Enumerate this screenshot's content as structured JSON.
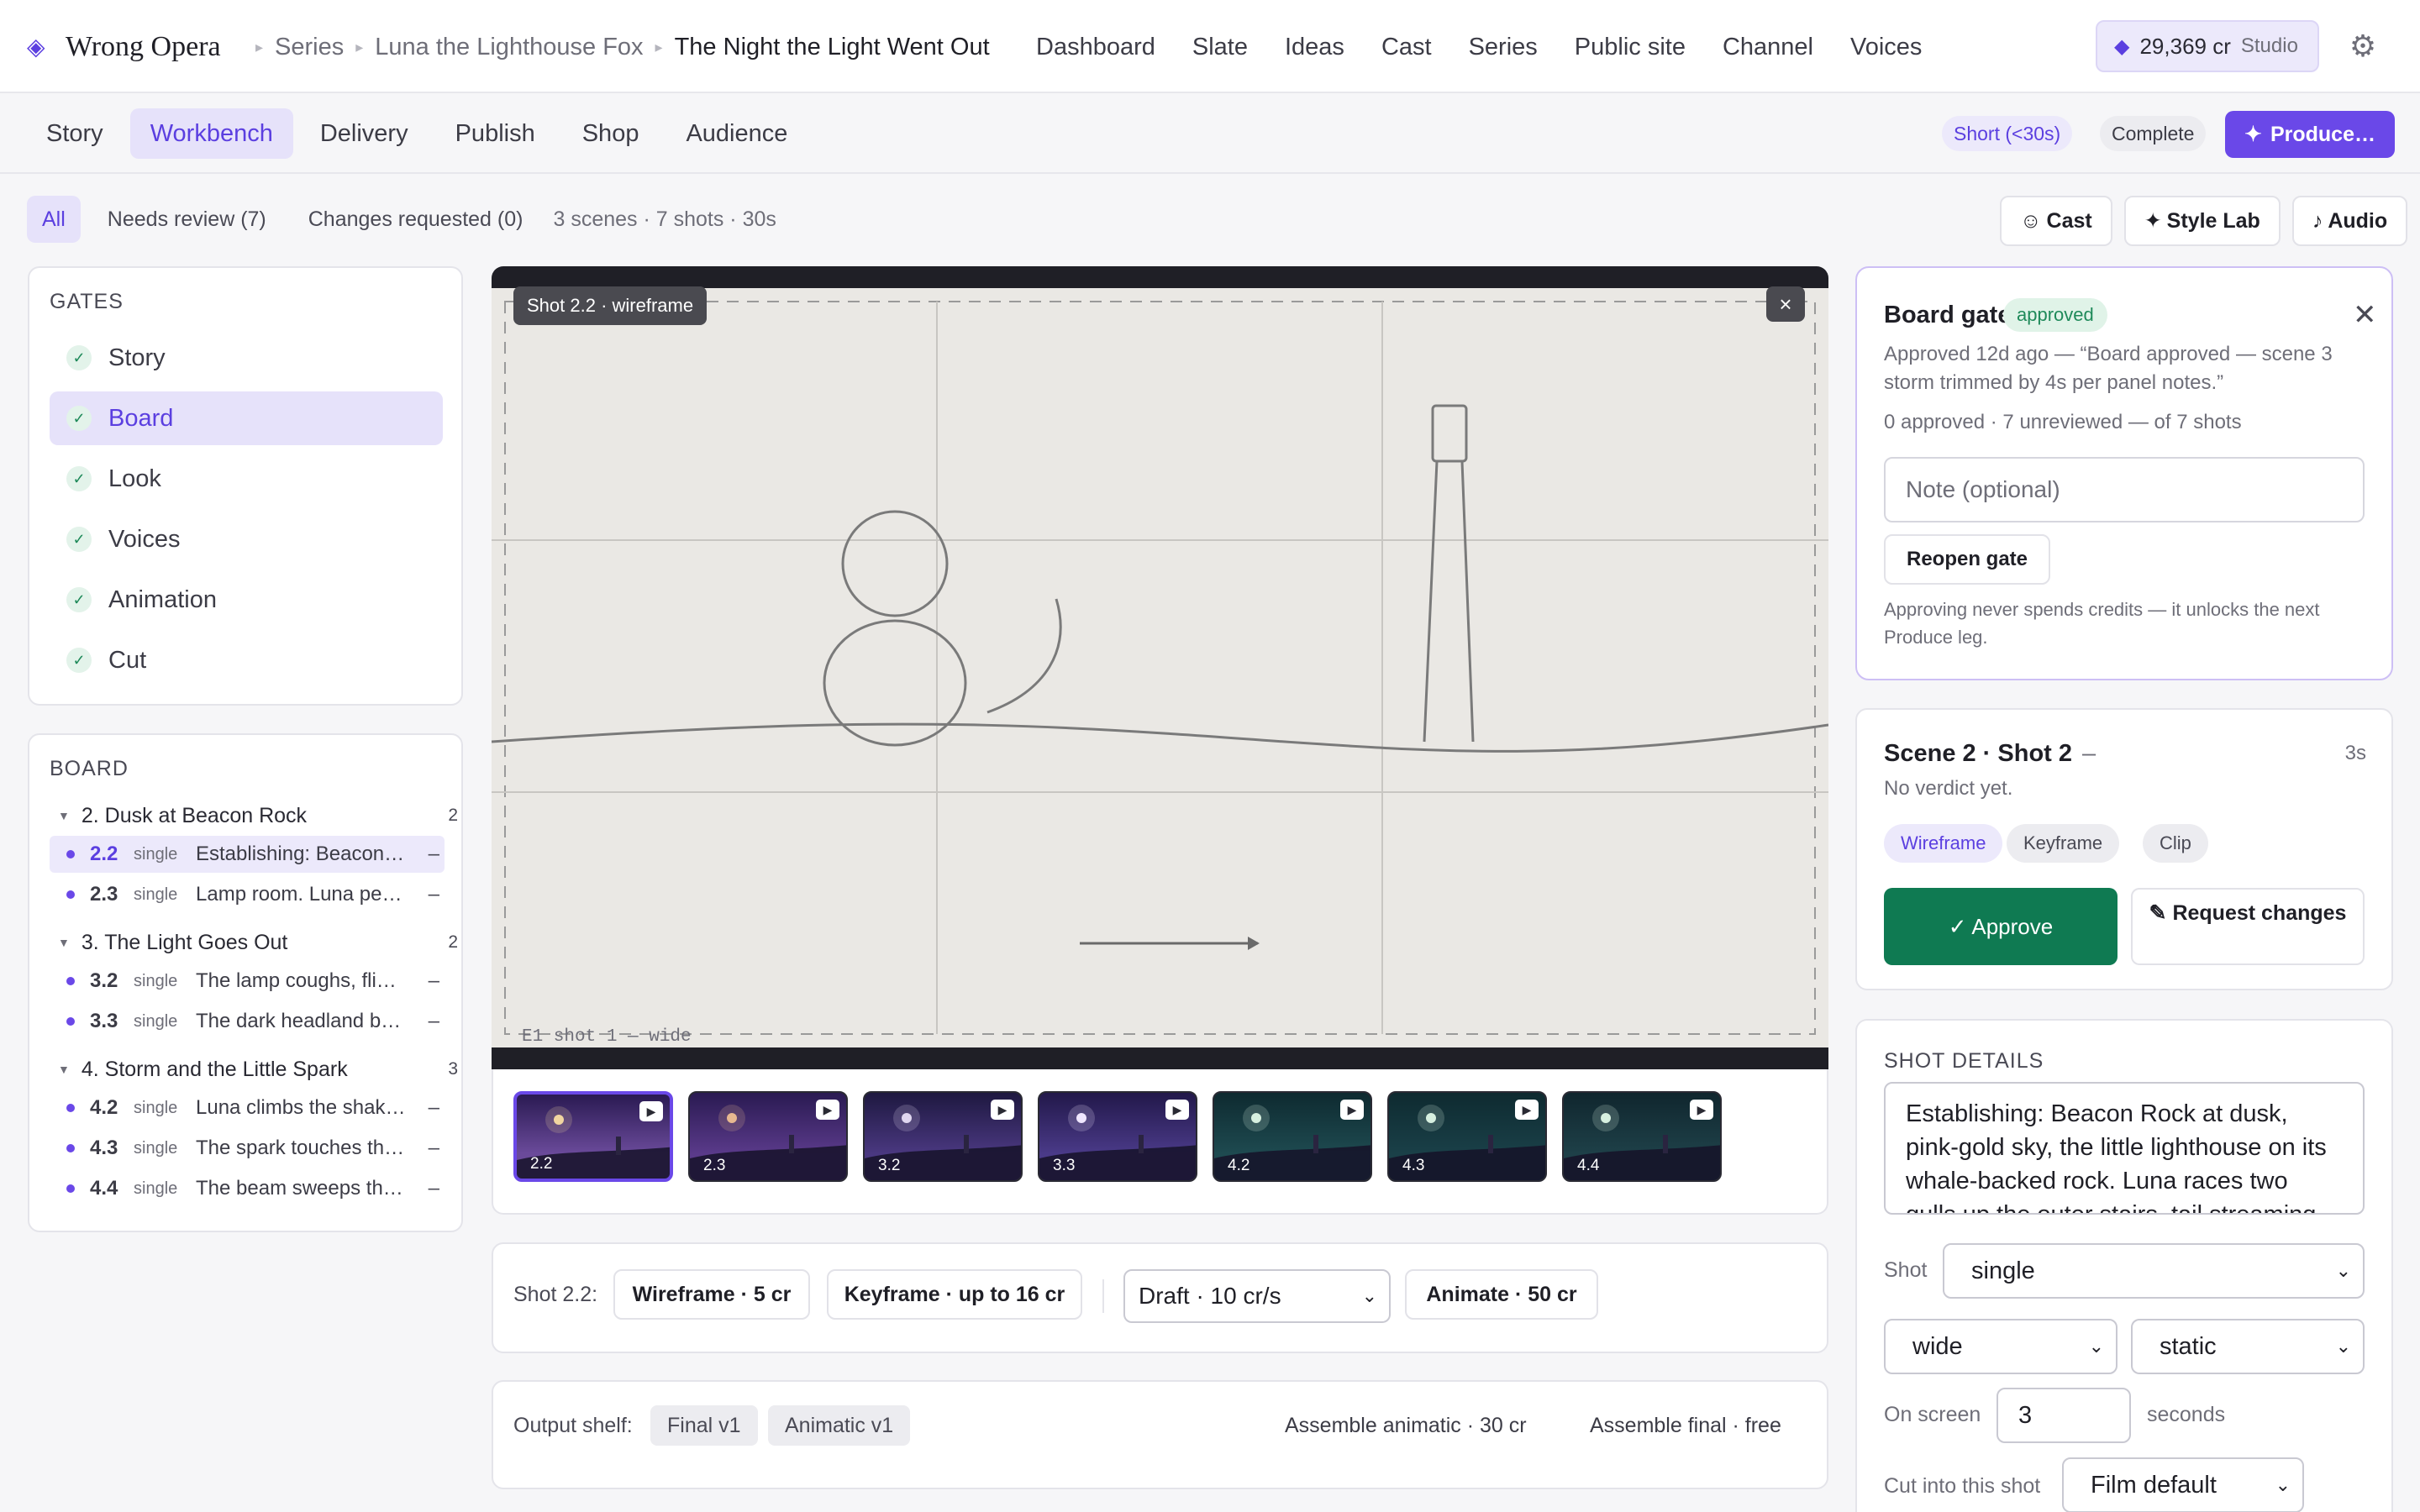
{
  "app": {
    "name": "Wrong Opera",
    "logo_icon": "diamond-icon"
  },
  "breadcrumb": [
    "Series",
    "Luna the Lighthouse Fox",
    "The Night the Light Went Out"
  ],
  "topnav": [
    "Dashboard",
    "Slate",
    "Ideas",
    "Cast",
    "Series",
    "Public site",
    "Channel",
    "Voices"
  ],
  "credits": {
    "amount": "29,369 cr",
    "plan": "Studio"
  },
  "tabs": [
    {
      "label": "Story"
    },
    {
      "label": "Workbench",
      "active": true
    },
    {
      "label": "Delivery"
    },
    {
      "label": "Publish"
    },
    {
      "label": "Shop"
    },
    {
      "label": "Audience"
    }
  ],
  "status": {
    "length": "Short (<30s)",
    "state": "Complete",
    "produce": "Produce…"
  },
  "filters": {
    "all": "All",
    "needs_review": "Needs review (7)",
    "changes": "Changes requested (0)",
    "meta": "3 scenes · 7 shots · 30s"
  },
  "tools": {
    "cast": "Cast",
    "style_lab": "Style Lab",
    "audio": "Audio"
  },
  "gates": {
    "title": "GATES",
    "items": [
      {
        "label": "Story"
      },
      {
        "label": "Board",
        "active": true
      },
      {
        "label": "Look"
      },
      {
        "label": "Voices"
      },
      {
        "label": "Animation"
      },
      {
        "label": "Cut"
      }
    ]
  },
  "board": {
    "title": "BOARD",
    "groups": [
      {
        "title": "2. Dusk at Beacon Rock",
        "count": "2",
        "shots": [
          {
            "num": "2.2",
            "kind": "single",
            "text": "Establishing: Beacon Rock at dusk",
            "mark": "–",
            "active": true
          },
          {
            "num": "2.3",
            "kind": "single",
            "text": "Lamp room. Luna peers in",
            "mark": "–"
          }
        ]
      },
      {
        "title": "3. The Light Goes Out",
        "count": "2",
        "shots": [
          {
            "num": "3.2",
            "kind": "single",
            "text": "The lamp coughs, flickers",
            "mark": "–"
          },
          {
            "num": "3.3",
            "kind": "single",
            "text": "The dark headland below",
            "mark": "–"
          }
        ]
      },
      {
        "title": "4. Storm and the Little Spark",
        "count": "3",
        "shots": [
          {
            "num": "4.2",
            "kind": "single",
            "text": "Luna climbs the shaking stairs",
            "mark": "–"
          },
          {
            "num": "4.3",
            "kind": "single",
            "text": "The spark touches the wick",
            "mark": "–"
          },
          {
            "num": "4.4",
            "kind": "single",
            "text": "The beam sweeps the sea",
            "mark": "–"
          }
        ]
      }
    ]
  },
  "viewer": {
    "badge": "Shot 2.2 · wireframe",
    "close": "×",
    "caption": "E1 shot 1 — wide",
    "thumbs": [
      {
        "label": "2.2",
        "active": true,
        "sky_top": "#2a1a52",
        "sky_bottom": "#6a4a9a",
        "orb": "#f2d6a0"
      },
      {
        "label": "2.3",
        "sky_top": "#2a1a52",
        "sky_bottom": "#5a3a8a",
        "orb": "#e8b890"
      },
      {
        "label": "3.2",
        "sky_top": "#1e1840",
        "sky_bottom": "#4a3880",
        "orb": "#e0d8f0"
      },
      {
        "label": "3.3",
        "sky_top": "#22184a",
        "sky_bottom": "#4a3a88",
        "orb": "#f0e8ff"
      },
      {
        "label": "4.2",
        "sky_top": "#0e2a30",
        "sky_bottom": "#1e4a50",
        "orb": "#d8f0e0"
      },
      {
        "label": "4.3",
        "sky_top": "#0e2a30",
        "sky_bottom": "#1a4048",
        "orb": "#d8f0e0"
      },
      {
        "label": "4.4",
        "sky_top": "#10262e",
        "sky_bottom": "#1e4048",
        "orb": "#d8f0e0"
      }
    ]
  },
  "actions": {
    "label": "Shot 2.2:",
    "wireframe": "Wireframe · 5 cr",
    "keyframe": "Keyframe · up to 16 cr",
    "draft": "Draft · 10 cr/s",
    "animate": "Animate · 50 cr"
  },
  "output": {
    "label": "Output shelf:",
    "chips": [
      "Final v1",
      "Animatic v1"
    ],
    "assemble_animatic": "Assemble animatic · 30 cr",
    "assemble_final": "Assemble final · free"
  },
  "gate_card": {
    "title": "Board gate",
    "badge": "approved",
    "text": "Approved 12d ago — “Board approved — scene 3 storm trimmed by 4s per panel notes.”",
    "count": "0 approved · 7 unreviewed — of 7 shots",
    "note_placeholder": "Note (optional)",
    "reopen": "Reopen gate",
    "footer": "Approving never spends credits — it unlocks the next Produce leg."
  },
  "shot_card": {
    "title": "Scene 2 · Shot 2",
    "dash": "–",
    "duration": "3s",
    "verdict": "No verdict yet.",
    "stages": [
      {
        "label": "Wireframe",
        "active": true
      },
      {
        "label": "Keyframe"
      },
      {
        "label": "Clip"
      }
    ],
    "approve": "✓ Approve",
    "request": "✎ Request changes"
  },
  "details": {
    "title": "SHOT DETAILS",
    "description": "Establishing: Beacon Rock at dusk, pink-gold sky, the little lighthouse on its whale-backed rock. Luna races two gulls up the outer stairs, tail streaming.",
    "shot_label": "Shot",
    "shot_type": "single",
    "framing": "wide",
    "motion": "static",
    "on_screen_label": "On screen",
    "on_screen_value": "3",
    "seconds_label": "seconds",
    "cut_label": "Cut into this shot",
    "cut_value": "Film default"
  }
}
